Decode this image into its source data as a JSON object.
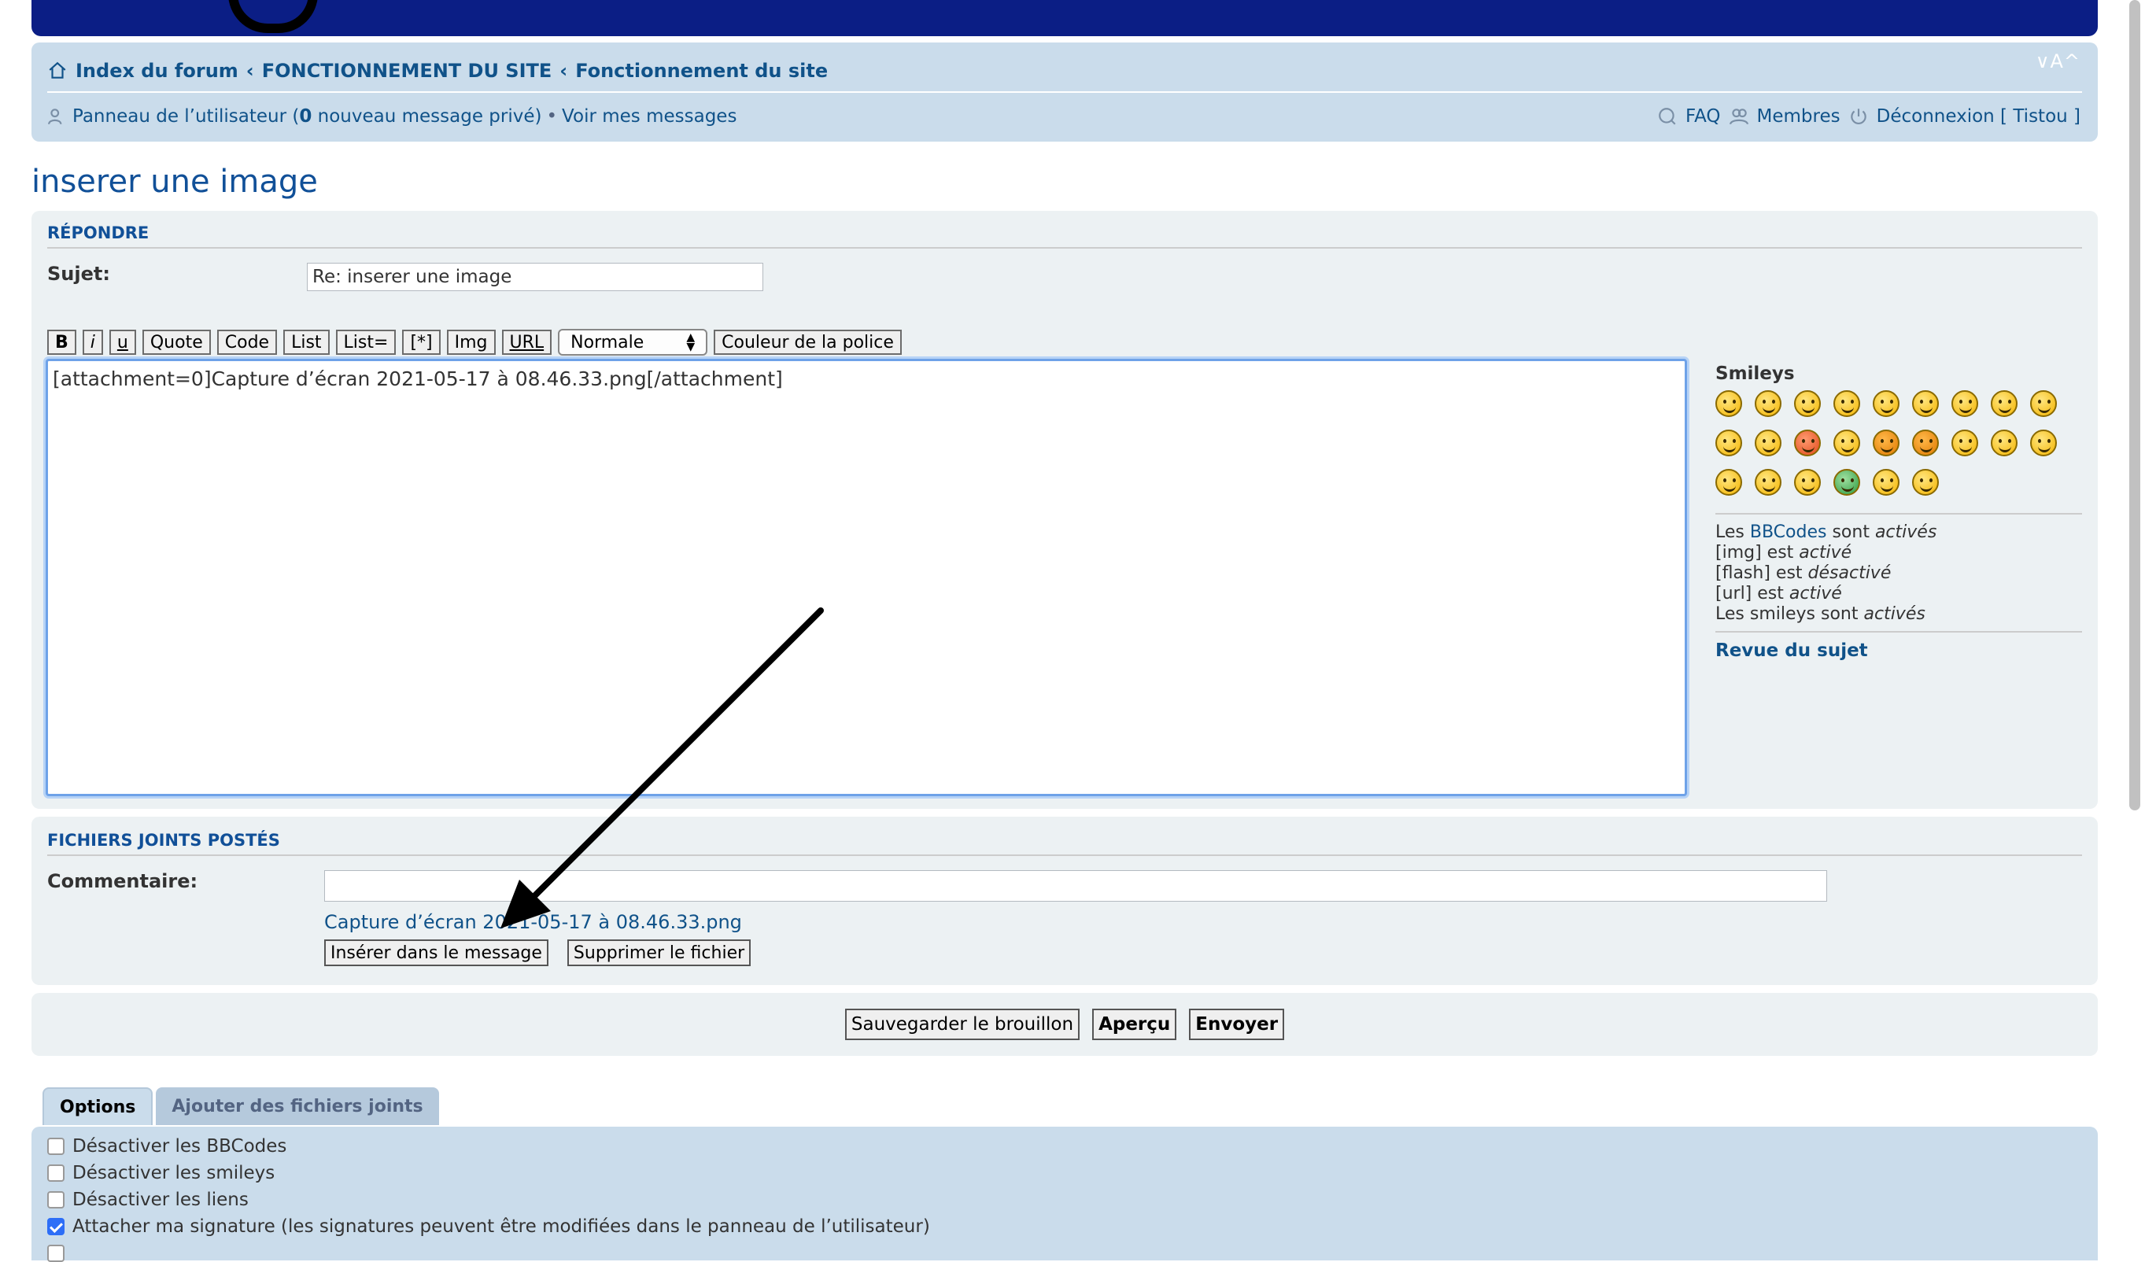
{
  "navbar": {
    "font_size_ctrl": "∨A^",
    "breadcrumbs": [
      "Index du forum",
      "FONCTIONNEMENT DU SITE",
      "Fonctionnement du site"
    ],
    "breadcrumb_sep": "‹",
    "user_panel": "Panneau de l’utilisateur (",
    "new_pm_count": "0",
    "new_pm_suffix": " nouveau message privé)",
    "bullet": "•",
    "view_posts": "Voir mes messages",
    "faq": "FAQ",
    "members": "Membres",
    "logout": "Déconnexion [ Tistou ]"
  },
  "page_title": "inserer une image",
  "reply": {
    "heading": "Répondre",
    "subject_label": "Sujet:",
    "subject_value": "Re: inserer une image",
    "toolbar": [
      "B",
      "i",
      "u",
      "Quote",
      "Code",
      "List",
      "List=",
      "[*]",
      "Img",
      "URL"
    ],
    "font_size_select": "Normale",
    "font_color_button": "Couleur de la police",
    "message": "[attachment=0]Capture d’écran 2021-05-17 à 08.46.33.png[/attachment]"
  },
  "smileys": {
    "heading": "Smileys",
    "icons": [
      "grin-icon",
      "smile-icon",
      "wink-icon",
      "neutral-icon",
      "surprised-icon",
      "eek-icon",
      "confused-icon",
      "cool-icon",
      "laughing-icon",
      "sad-icon",
      "razz-icon",
      "mad-icon",
      "rolleyes-icon",
      "evil-icon",
      "twisted-icon",
      "crazy-icon",
      "exclaim-icon",
      "question-icon",
      "idea-icon",
      "arrow-icon",
      "neutral2-icon",
      "green-icon",
      "geek-icon",
      "uber-geek-icon"
    ],
    "status_lines": [
      {
        "pre": "Les ",
        "link": "BBCodes",
        "post": " sont ",
        "em": "activés"
      },
      {
        "pre": "[img] est ",
        "link": "",
        "post": "",
        "em": "activé"
      },
      {
        "pre": "[flash] est ",
        "link": "",
        "post": "",
        "em": "désactivé"
      },
      {
        "pre": "[url] est ",
        "link": "",
        "post": "",
        "em": "activé"
      },
      {
        "pre": "Les smileys sont ",
        "link": "",
        "post": "",
        "em": "activés"
      }
    ],
    "topic_review": "Revue du sujet"
  },
  "attachments": {
    "heading": "Fichiers joints postés",
    "comment_label": "Commentaire:",
    "filename": "Capture d’écran 2021-05-17 à 08.46.33.png",
    "insert_button": "Insérer dans le message",
    "delete_button": "Supprimer le fichier"
  },
  "submit": {
    "save_draft": "Sauvegarder le brouillon",
    "preview": "Aperçu",
    "send": "Envoyer"
  },
  "tabs": [
    "Options",
    "Ajouter des fichiers joints"
  ],
  "options": [
    {
      "label": "Désactiver les BBCodes",
      "checked": false
    },
    {
      "label": "Désactiver les smileys",
      "checked": false
    },
    {
      "label": "Désactiver les liens",
      "checked": false
    },
    {
      "label": "Attacher ma signature (les signatures peuvent être modifiées dans le panneau de l’utilisateur)",
      "checked": true
    }
  ],
  "colors": {
    "banner": "#0b1e85",
    "panel": "#ecf1f3",
    "navbar": "#cadceb",
    "link": "#105289",
    "heading": "#115098",
    "checkbox_checked": "#2d6ef7"
  }
}
